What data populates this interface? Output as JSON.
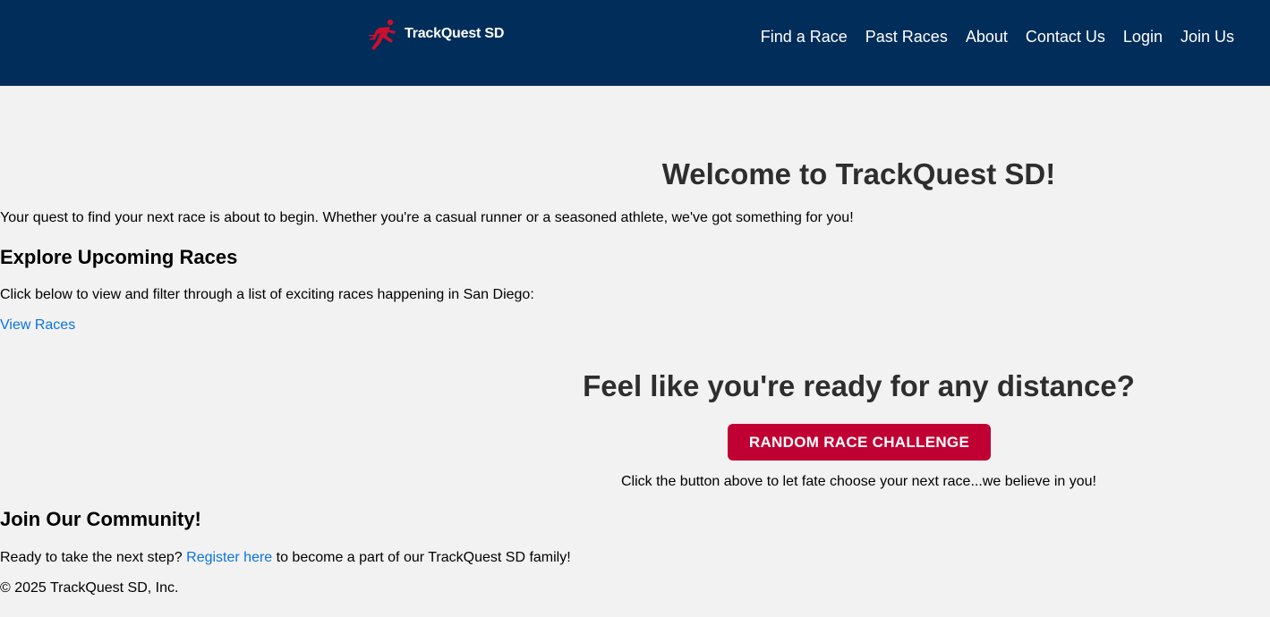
{
  "header": {
    "logo_text": "TrackQuest SD",
    "nav": [
      "Find a Race",
      "Past Races",
      "About",
      "Contact Us",
      "Login",
      "Join Us"
    ]
  },
  "welcome": {
    "title": "Welcome to TrackQuest SD!",
    "intro": "Your quest to find your next race is about to begin. Whether you're a casual runner or a seasoned athlete, we've got something for you!"
  },
  "explore": {
    "title": "Explore Upcoming Races",
    "text": "Click below to view and filter through a list of exciting races happening in San Diego:",
    "link": "View Races"
  },
  "challenge": {
    "title": "Feel like you're ready for any distance?",
    "button": "RANDOM RACE CHALLENGE",
    "text": "Click the button above to let fate choose your next race...we believe in you!"
  },
  "community": {
    "title": "Join Our Community!",
    "text_before": "Ready to take the next step?",
    "link": "Register here",
    "text_after": "to become a part of our TrackQuest SD family!"
  },
  "footer": {
    "copyright": "© 2025 TrackQuest SD, Inc."
  },
  "colors": {
    "header_bg": "#002d5a",
    "page_bg": "#f2f2f2",
    "button_bg": "#c00033",
    "link": "#0a74e0",
    "logo_icon": "#c8102e"
  },
  "icons": {
    "logo": "runner-icon"
  }
}
